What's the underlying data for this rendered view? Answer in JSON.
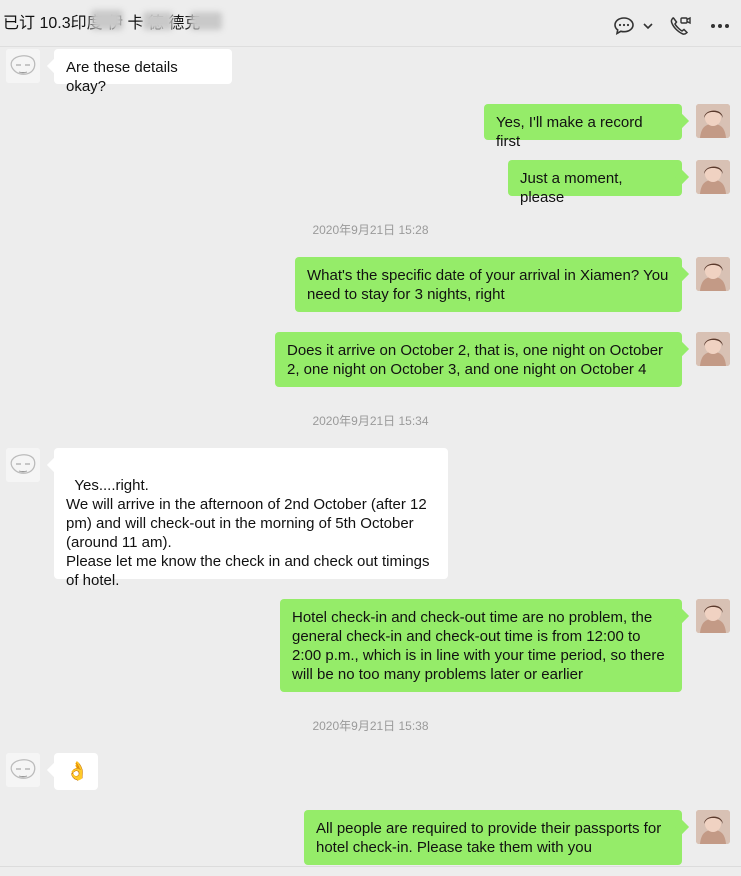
{
  "header": {
    "title": "已订 10.3印度    伊    卡 德     德克",
    "icons": [
      "chat-bubble-icon",
      "chevron-down-icon",
      "video-call-icon",
      "more-icon"
    ]
  },
  "messages": [
    {
      "side": "left",
      "text": "Are these details okay?"
    },
    {
      "side": "right",
      "text": "Yes, I'll make a record first"
    },
    {
      "side": "right",
      "text": "Just a moment, please"
    },
    {
      "timestamp": "2020年9月21日 15:28"
    },
    {
      "side": "right",
      "text": "What's the specific date of your arrival in Xiamen? You need to stay for 3 nights, right"
    },
    {
      "side": "right",
      "text": "Does it arrive on October 2, that is, one night on October 2, one night on October 3, and one night on October 4"
    },
    {
      "timestamp": "2020年9月21日 15:34"
    },
    {
      "side": "left",
      "text": "Yes....right.\nWe will arrive in the afternoon of 2nd October (after 12 pm) and will check-out in the morning of 5th October (around 11 am).\nPlease let me know the check in and check out timings of hotel."
    },
    {
      "side": "right",
      "text": "Hotel check-in and check-out time are no problem, the general check-in and check-out time is from 12:00 to 2:00 p.m., which is in line with your time period, so there will be no too many problems later or earlier"
    },
    {
      "timestamp": "2020年9月21日 15:38"
    },
    {
      "side": "left",
      "text": "👌"
    },
    {
      "side": "right",
      "text": "All people are required to provide their passports for hotel check-in. Please take them with you"
    }
  ]
}
